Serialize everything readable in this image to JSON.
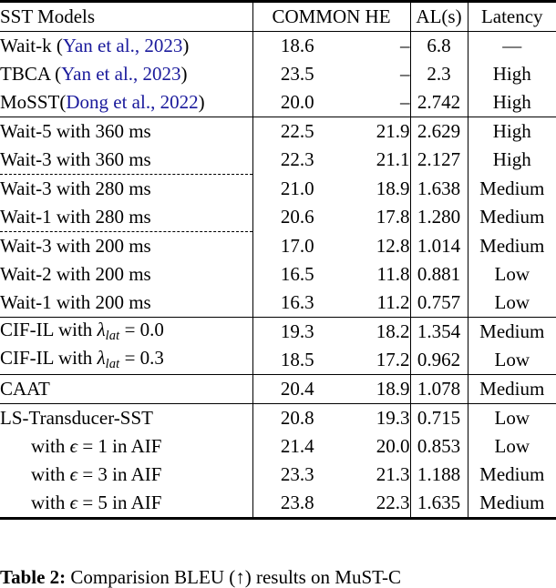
{
  "table": {
    "headers": {
      "model": "SST Models",
      "common_he": "COMMON  HE",
      "common": "COMMON",
      "he": "HE",
      "al": "AL(s)",
      "latency": "Latency"
    },
    "groups": [
      {
        "rows": [
          {
            "model_prefix": "Wait-k (",
            "citation": "Yan et al., 2023",
            "model_suffix": ")",
            "common": "18.6",
            "he": "–",
            "al": "6.8",
            "latency": "—",
            "bold": false
          },
          {
            "model_prefix": "TBCA (",
            "citation": "Yan et al., 2023",
            "model_suffix": ")",
            "common": "23.5",
            "he": "–",
            "al": "2.3",
            "latency": "High",
            "bold": false
          },
          {
            "model_prefix": "MoSST(",
            "citation": "Dong et al., 2022",
            "model_suffix": ")",
            "common": "20.0",
            "he": "–",
            "al": "2.742",
            "latency": "High",
            "bold": false
          }
        ]
      },
      {
        "rows": [
          {
            "model": "Wait-5 with 360 ms",
            "common": "22.5",
            "he": "21.9",
            "al": "2.629",
            "latency": "High",
            "bold": false
          },
          {
            "model": "Wait-3 with 360 ms",
            "common": "22.3",
            "he": "21.1",
            "al": "2.127",
            "latency": "High",
            "bold": false
          },
          {
            "model": "Wait-3 with 280 ms",
            "common": "21.0",
            "he": "18.9",
            "al": "1.638",
            "latency": "Medium",
            "bold": false,
            "dashed_above": true
          },
          {
            "model": "Wait-1 with 280 ms",
            "common": "20.6",
            "he": "17.8",
            "al": "1.280",
            "latency": "Medium",
            "bold": false
          },
          {
            "model": "Wait-3 with 200 ms",
            "common": "17.0",
            "he": "12.8",
            "al": "1.014",
            "latency": "Medium",
            "bold": false,
            "dashed_above": true
          },
          {
            "model": "Wait-2 with 200 ms",
            "common": "16.5",
            "he": "11.8",
            "al": "0.881",
            "latency": "Low",
            "bold": false
          },
          {
            "model": "Wait-1 with 200 ms",
            "common": "16.3",
            "he": "11.2",
            "al": "0.757",
            "latency": "Low",
            "bold": false
          }
        ]
      },
      {
        "rows": [
          {
            "model_math": "cif-lambda",
            "model_pre": "CIF-IL with ",
            "model_sym": "λ",
            "model_sub": "lat",
            "model_post": " = 0.0",
            "common": "19.3",
            "he": "18.2",
            "al": "1.354",
            "latency": "Medium",
            "bold": false
          },
          {
            "model_math": "cif-lambda",
            "model_pre": "CIF-IL with ",
            "model_sym": "λ",
            "model_sub": "lat",
            "model_post": " = 0.3",
            "common": "18.5",
            "he": "17.2",
            "al": "0.962",
            "latency": "Low",
            "bold": false
          }
        ]
      },
      {
        "rows": [
          {
            "model": "CAAT",
            "common": "20.4",
            "he": "18.9",
            "al": "1.078",
            "latency": "Medium",
            "bold": false
          }
        ]
      },
      {
        "rows": [
          {
            "model": "LS-Transducer-SST",
            "common": "20.8",
            "he": "19.3",
            "al": "0.715",
            "latency": "Low",
            "bold": false
          },
          {
            "model_math": "eps",
            "model_pre": "with ",
            "model_sym": "ϵ",
            "model_post": " = 1 in AIF",
            "indent": true,
            "common": "21.4",
            "he": "20.0",
            "al": "0.853",
            "latency": "Low",
            "bold": true
          },
          {
            "model_math": "eps",
            "model_pre": "with ",
            "model_sym": "ϵ",
            "model_post": " = 3 in AIF",
            "indent": true,
            "common": "23.3",
            "he": "21.3",
            "al": "1.188",
            "latency": "Medium",
            "bold": false
          },
          {
            "model_math": "eps",
            "model_pre": "with ",
            "model_sym": "ϵ",
            "model_post": " = 5 in AIF",
            "indent": true,
            "common": "23.8",
            "he": "22.3",
            "al": "1.635",
            "latency": "Medium",
            "bold": true
          }
        ]
      }
    ]
  },
  "caption": {
    "label": "Table 2:",
    "text": " Comparision BLEU (↑) results on MuST-C"
  },
  "colors": {
    "citation_link": "#1a1a9c",
    "rule": "#000000",
    "text": "#000000",
    "background": "#ffffff"
  }
}
